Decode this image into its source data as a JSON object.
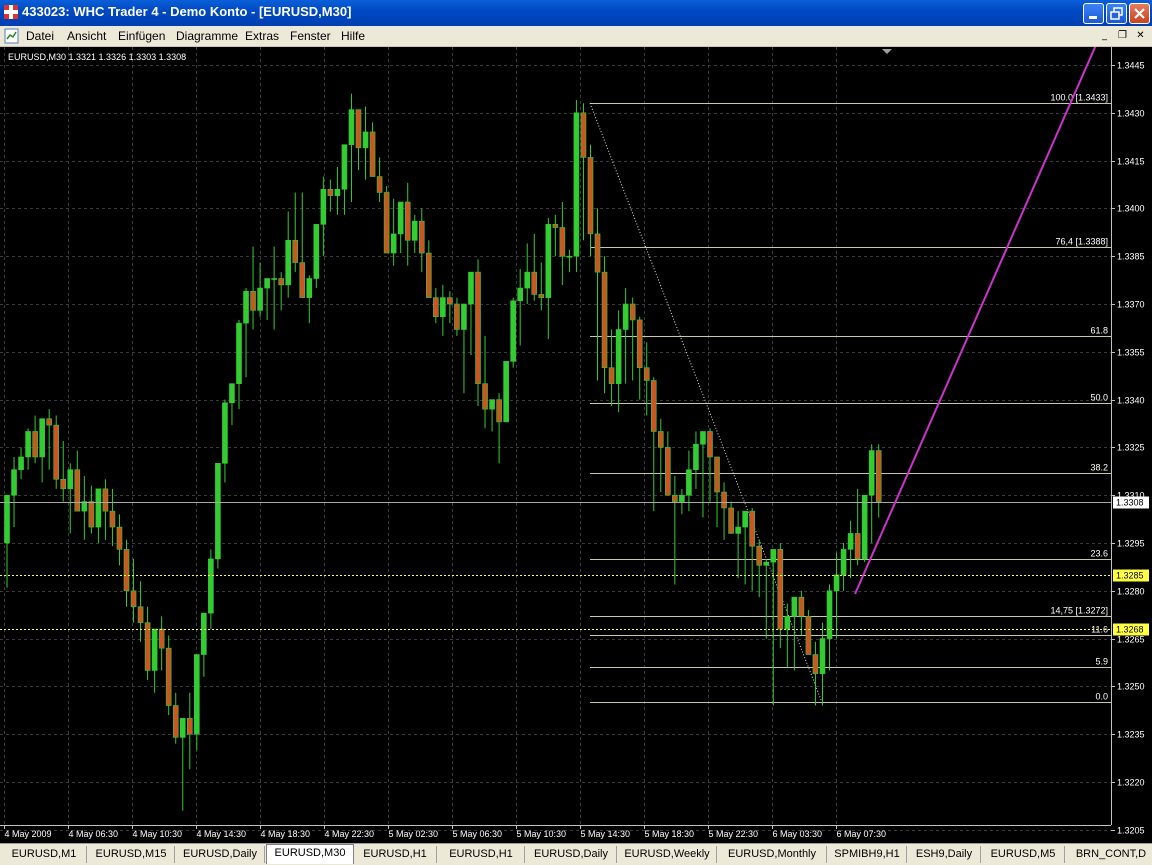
{
  "window": {
    "title": "433023: WHC Trader 4 - Demo Konto - [EURUSD,M30]",
    "controls": [
      "minimize-icon",
      "restore-icon",
      "close-icon"
    ]
  },
  "menu": {
    "items": [
      "Datei",
      "Ansicht",
      "Einfügen",
      "Diagramme",
      "Extras",
      "Fenster",
      "Hilfe"
    ]
  },
  "chart": {
    "symbol_info": "EURUSD,M30  1.3321 1.3326 1.3303 1.3308",
    "price_labels": [
      "1.3445",
      "1.3430",
      "1.3415",
      "1.3400",
      "1.3385",
      "1.3370",
      "1.3355",
      "1.3340",
      "1.3325",
      "1.3310",
      "1.3295",
      "1.3280",
      "1.3265",
      "1.3250",
      "1.3235",
      "1.3220",
      "1.3205"
    ],
    "time_labels": [
      "4 May 2009",
      "4 May 06:30",
      "4 May 10:30",
      "4 May 14:30",
      "4 May 18:30",
      "4 May 22:30",
      "5 May 02:30",
      "5 May 06:30",
      "5 May 10:30",
      "5 May 14:30",
      "5 May 18:30",
      "5 May 22:30",
      "6 May 03:30",
      "6 May 07:30"
    ],
    "current_price": "1.3308",
    "marker_prices": [
      "1.3285",
      "1.3268"
    ],
    "fib_labels": [
      "100.0  [1.3433]",
      "76,4  [1.3388]",
      "61.8",
      "50.0",
      "38.2",
      "23.6",
      "14,75  [1.3272]",
      "11.6",
      "5.9",
      "0.0"
    ],
    "colors": {
      "bull": "#33cc33",
      "bear": "#cc5522",
      "grid": "#3a3a3a",
      "fib": "#c8c8a0",
      "trend": "#cc33cc",
      "marker": "#ffff44"
    },
    "current_price_value": 1.3308,
    "marker_values": [
      1.3285,
      1.3268
    ],
    "fib_values": [
      1.3433,
      1.3388,
      1.336,
      1.3339,
      1.3317,
      1.329,
      1.3272,
      1.3266,
      1.3256,
      1.3245
    ]
  },
  "chart_data": {
    "type": "candlestick",
    "symbol": "EURUSD",
    "timeframe": "M30",
    "ylim": [
      1.32,
      1.3452
    ],
    "open": [
      1.3295,
      1.331,
      1.3318,
      1.3322,
      1.333,
      1.3322,
      1.3334,
      1.3332,
      1.3315,
      1.3312,
      1.3318,
      1.3305,
      1.3308,
      1.33,
      1.3312,
      1.3305,
      1.33,
      1.3293,
      1.328,
      1.3275,
      1.327,
      1.3255,
      1.3268,
      1.3262,
      1.3244,
      1.3234,
      1.324,
      1.3235,
      1.326,
      1.3273,
      1.329,
      1.332,
      1.3339,
      1.3345,
      1.3364,
      1.3374,
      1.3368,
      1.3375,
      1.3378,
      1.3378,
      1.3376,
      1.339,
      1.3383,
      1.3372,
      1.3378,
      1.3395,
      1.3406,
      1.3404,
      1.3406,
      1.342,
      1.3431,
      1.3419,
      1.3424,
      1.341,
      1.3405,
      1.3386,
      1.3392,
      1.3402,
      1.339,
      1.3396,
      1.3386,
      1.3372,
      1.3366,
      1.3372,
      1.337,
      1.3362,
      1.337,
      1.338,
      1.3345,
      1.3337,
      1.334,
      1.3333,
      1.3352,
      1.3371,
      1.3375,
      1.338,
      1.3373,
      1.3372,
      1.3395,
      1.3394,
      1.3385,
      1.3385,
      1.343,
      1.3416,
      1.3392,
      1.338,
      1.335,
      1.3345,
      1.3362,
      1.337,
      1.3365,
      1.335,
      1.3346,
      1.333,
      1.3325,
      1.331,
      1.3308,
      1.331,
      1.3318,
      1.3326,
      1.333,
      1.3322,
      1.3311,
      1.3306,
      1.3298,
      1.33,
      1.3305,
      1.3294,
      1.3288,
      1.3289,
      1.3293,
      1.3268,
      1.3272,
      1.3278,
      1.3272,
      1.326,
      1.3254,
      1.3265,
      1.328,
      1.3285,
      1.3293,
      1.3298,
      1.329,
      1.331,
      1.3324
    ],
    "high": [
      1.3305,
      1.3322,
      1.3325,
      1.3331,
      1.3335,
      1.3332,
      1.3337,
      1.3335,
      1.3327,
      1.332,
      1.3324,
      1.3316,
      1.3313,
      1.3312,
      1.3315,
      1.3312,
      1.3304,
      1.3296,
      1.329,
      1.3283,
      1.3275,
      1.3262,
      1.3272,
      1.3266,
      1.3248,
      1.3238,
      1.3248,
      1.325,
      1.3268,
      1.3293,
      1.33,
      1.334,
      1.3341,
      1.3365,
      1.3375,
      1.3388,
      1.3383,
      1.3378,
      1.3388,
      1.338,
      1.3399,
      1.3405,
      1.3405,
      1.3379,
      1.339,
      1.341,
      1.3409,
      1.3413,
      1.3412,
      1.3436,
      1.3431,
      1.3432,
      1.3427,
      1.3416,
      1.3407,
      1.3403,
      1.3399,
      1.3408,
      1.3398,
      1.34,
      1.339,
      1.3375,
      1.3376,
      1.3374,
      1.3372,
      1.3366,
      1.338,
      1.3384,
      1.336,
      1.334,
      1.3342,
      1.3346,
      1.3372,
      1.3381,
      1.3389,
      1.3392,
      1.3383,
      1.3397,
      1.3398,
      1.3402,
      1.3387,
      1.3434,
      1.3433,
      1.342,
      1.34,
      1.3385,
      1.3362,
      1.3368,
      1.3375,
      1.3372,
      1.3366,
      1.3358,
      1.3347,
      1.3334,
      1.333,
      1.3316,
      1.3312,
      1.3324,
      1.333,
      1.3328,
      1.3331,
      1.3322,
      1.3314,
      1.3308,
      1.3305,
      1.3303,
      1.3306,
      1.3296,
      1.329,
      1.3292,
      1.3295,
      1.3276,
      1.3276,
      1.328,
      1.3274,
      1.3264,
      1.327,
      1.3282,
      1.3292,
      1.3295,
      1.3302,
      1.3312,
      1.3304,
      1.3326,
      1.3326
    ],
    "low": [
      1.3281,
      1.33,
      1.3315,
      1.3318,
      1.332,
      1.3314,
      1.3318,
      1.3312,
      1.3308,
      1.3298,
      1.3307,
      1.3296,
      1.3298,
      1.3295,
      1.3296,
      1.3294,
      1.3288,
      1.3275,
      1.327,
      1.3264,
      1.3252,
      1.3248,
      1.3255,
      1.3241,
      1.3232,
      1.3211,
      1.3224,
      1.323,
      1.3253,
      1.3268,
      1.3287,
      1.3314,
      1.3332,
      1.3337,
      1.3347,
      1.3362,
      1.3366,
      1.3365,
      1.3362,
      1.3368,
      1.3372,
      1.338,
      1.3372,
      1.3364,
      1.3375,
      1.3385,
      1.3399,
      1.3398,
      1.3398,
      1.3402,
      1.3412,
      1.3409,
      1.3415,
      1.3402,
      1.3386,
      1.3382,
      1.3386,
      1.3382,
      1.3386,
      1.338,
      1.3374,
      1.3364,
      1.336,
      1.3364,
      1.336,
      1.3342,
      1.3354,
      1.3338,
      1.3331,
      1.333,
      1.332,
      1.3333,
      1.335,
      1.3357,
      1.337,
      1.3371,
      1.3368,
      1.3359,
      1.3385,
      1.3376,
      1.338,
      1.338,
      1.339,
      1.3385,
      1.3346,
      1.3342,
      1.3338,
      1.3336,
      1.3345,
      1.3346,
      1.334,
      1.3335,
      1.3305,
      1.3311,
      1.3316,
      1.3282,
      1.3304,
      1.3305,
      1.3312,
      1.3303,
      1.3308,
      1.33,
      1.3296,
      1.3298,
      1.3284,
      1.3282,
      1.328,
      1.3278,
      1.3265,
      1.3244,
      1.3262,
      1.3256,
      1.3255,
      1.3266,
      1.3265,
      1.3244,
      1.3244,
      1.3255,
      1.3265,
      1.328,
      1.3284,
      1.3288,
      1.3289,
      1.3295,
      1.3303
    ],
    "close": [
      1.331,
      1.3318,
      1.3322,
      1.333,
      1.3322,
      1.3334,
      1.3332,
      1.3315,
      1.3312,
      1.3318,
      1.3305,
      1.3308,
      1.33,
      1.3312,
      1.3305,
      1.33,
      1.3293,
      1.328,
      1.3275,
      1.327,
      1.3255,
      1.3268,
      1.3262,
      1.3244,
      1.3234,
      1.324,
      1.3235,
      1.326,
      1.3273,
      1.329,
      1.332,
      1.3339,
      1.3345,
      1.3364,
      1.3374,
      1.3368,
      1.3375,
      1.3378,
      1.3378,
      1.3376,
      1.339,
      1.3383,
      1.3372,
      1.3378,
      1.3395,
      1.3406,
      1.3404,
      1.3406,
      1.342,
      1.3431,
      1.3419,
      1.3424,
      1.341,
      1.3405,
      1.3386,
      1.3392,
      1.3402,
      1.339,
      1.3396,
      1.3386,
      1.3372,
      1.3366,
      1.3372,
      1.337,
      1.3362,
      1.337,
      1.338,
      1.3345,
      1.3337,
      1.334,
      1.3333,
      1.3352,
      1.3371,
      1.3375,
      1.338,
      1.3373,
      1.3372,
      1.3395,
      1.3394,
      1.3385,
      1.3385,
      1.343,
      1.3416,
      1.3392,
      1.338,
      1.335,
      1.3345,
      1.3362,
      1.337,
      1.3365,
      1.335,
      1.3346,
      1.333,
      1.3325,
      1.331,
      1.3308,
      1.331,
      1.3318,
      1.3326,
      1.333,
      1.3322,
      1.3311,
      1.3306,
      1.3298,
      1.33,
      1.3305,
      1.3294,
      1.3288,
      1.3289,
      1.3293,
      1.3268,
      1.3272,
      1.3278,
      1.3272,
      1.326,
      1.3254,
      1.3265,
      1.328,
      1.3285,
      1.3293,
      1.3298,
      1.329,
      1.331,
      1.3324,
      1.3308
    ]
  },
  "tabs": [
    {
      "label": "EURUSD,M1",
      "active": false
    },
    {
      "label": "EURUSD,M15",
      "active": false
    },
    {
      "label": "EURUSD,Daily",
      "active": false
    },
    {
      "label": "EURUSD,M30",
      "active": true
    },
    {
      "label": "EURUSD,H1",
      "active": false
    },
    {
      "label": "EURUSD,H1",
      "active": false
    },
    {
      "label": "EURUSD,Daily",
      "active": false
    },
    {
      "label": "EURUSD,Weekly",
      "active": false
    },
    {
      "label": "EURUSD,Monthly",
      "active": false
    },
    {
      "label": "SPMIBH9,H1",
      "active": false
    },
    {
      "label": "ESH9,Daily",
      "active": false
    },
    {
      "label": "EURUSD,M5",
      "active": false
    },
    {
      "label": "BRN_CONT,D",
      "active": false
    }
  ]
}
